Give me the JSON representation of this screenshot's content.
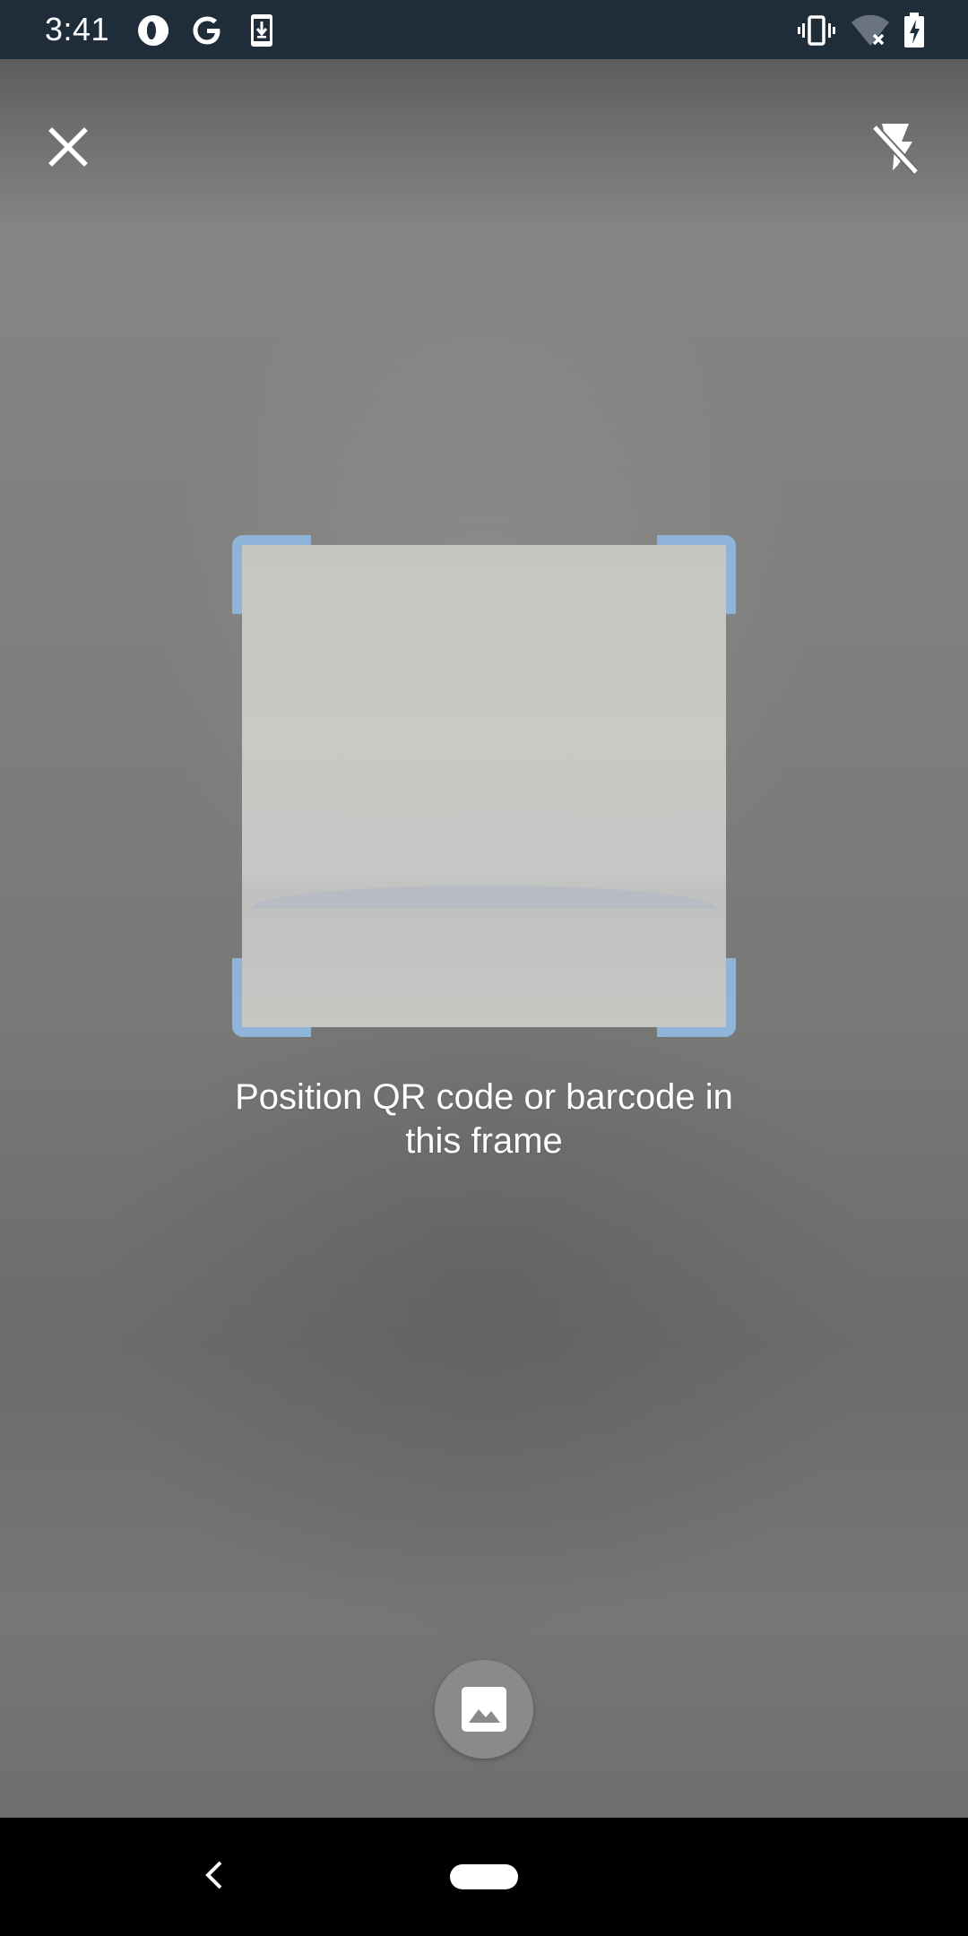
{
  "status_bar": {
    "time": "3:41",
    "left_icons": [
      "opera-icon",
      "google-icon",
      "download-icon"
    ],
    "right_icons": [
      "vibrate-icon",
      "wifi-off-icon",
      "battery-charging-icon"
    ]
  },
  "toolbar": {
    "close_icon": "close-icon",
    "flash_icon": "flash-off-icon"
  },
  "scanner": {
    "instruction": "Position QR code or barcode in this frame",
    "frame_color": "#8fb4d9"
  },
  "gallery": {
    "icon": "image-icon"
  },
  "navigation": {
    "back_icon": "back-icon",
    "home_icon": "home-pill-icon"
  },
  "colors": {
    "status_bar_bg": "#1f2d3b",
    "nav_bar_bg": "#000000",
    "accent": "#8fb4d9"
  }
}
